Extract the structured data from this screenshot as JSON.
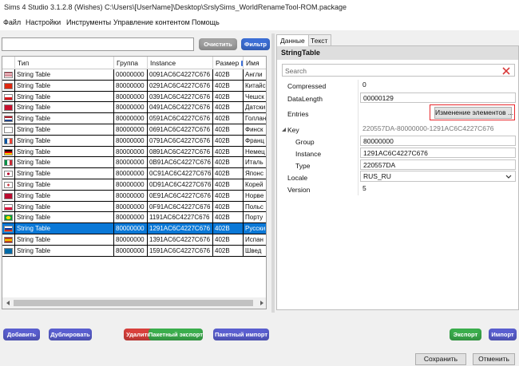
{
  "window": {
    "title": "Sims 4 Studio 3.1.2.8 (Wishes)  C:\\Users\\[UserName]\\Desktop\\SrslySims_WorldRenameTool-ROM.package"
  },
  "menu": [
    "Файл",
    "Настройки",
    "Инструменты",
    "Управление контентом",
    "Помощь"
  ],
  "filter": {
    "value": "",
    "clear_label": "Очистить",
    "filter_label": "Фильтр"
  },
  "table": {
    "columns": [
      "",
      "Тип",
      "Группа",
      "Instance",
      "Размер",
      "Имя"
    ],
    "rows": [
      {
        "flag": "us",
        "type": "String Table",
        "group": "00000000",
        "instance": "0091AC6C4227C676",
        "size": "402B",
        "name": "Англи"
      },
      {
        "flag": "cn",
        "type": "String Table",
        "group": "80000000",
        "instance": "0291AC6C4227C676",
        "size": "402B",
        "name": "Китайс"
      },
      {
        "flag": "cz",
        "type": "String Table",
        "group": "80000000",
        "instance": "0391AC6C4227C676",
        "size": "402B",
        "name": "Чешск"
      },
      {
        "flag": "dk",
        "type": "String Table",
        "group": "80000000",
        "instance": "0491AC6C4227C676",
        "size": "402B",
        "name": "Датски"
      },
      {
        "flag": "nl",
        "type": "String Table",
        "group": "80000000",
        "instance": "0591AC6C4227C676",
        "size": "402B",
        "name": "Голлан"
      },
      {
        "flag": "fi",
        "type": "String Table",
        "group": "80000000",
        "instance": "0691AC6C4227C676",
        "size": "402B",
        "name": "Финск"
      },
      {
        "flag": "fr",
        "type": "String Table",
        "group": "80000000",
        "instance": "0791AC6C4227C676",
        "size": "402B",
        "name": "Франц"
      },
      {
        "flag": "de",
        "type": "String Table",
        "group": "80000000",
        "instance": "0891AC6C4227C676",
        "size": "402B",
        "name": "Немец"
      },
      {
        "flag": "it",
        "type": "String Table",
        "group": "80000000",
        "instance": "0B91AC6C4227C676",
        "size": "402B",
        "name": "Италь"
      },
      {
        "flag": "jp",
        "type": "String Table",
        "group": "80000000",
        "instance": "0C91AC6C4227C676",
        "size": "402B",
        "name": "Японс"
      },
      {
        "flag": "kr",
        "type": "String Table",
        "group": "80000000",
        "instance": "0D91AC6C4227C676",
        "size": "402B",
        "name": "Корей"
      },
      {
        "flag": "no",
        "type": "String Table",
        "group": "80000000",
        "instance": "0E91AC6C4227C676",
        "size": "402B",
        "name": "Норве"
      },
      {
        "flag": "pl",
        "type": "String Table",
        "group": "80000000",
        "instance": "0F91AC6C4227C676",
        "size": "402B",
        "name": "Польс"
      },
      {
        "flag": "br",
        "type": "String Table",
        "group": "80000000",
        "instance": "1191AC6C4227C676",
        "size": "402B",
        "name": "Порту"
      },
      {
        "flag": "ru",
        "type": "String Table",
        "group": "80000000",
        "instance": "1291AC6C4227C676",
        "size": "402B",
        "name": "Русски",
        "selected": true
      },
      {
        "flag": "es",
        "type": "String Table",
        "group": "80000000",
        "instance": "1391AC6C4227C676",
        "size": "402B",
        "name": "Испан"
      },
      {
        "flag": "se",
        "type": "String Table",
        "group": "80000000",
        "instance": "1591AC6C4227C676",
        "size": "402B",
        "name": "Швед"
      }
    ]
  },
  "tabs": {
    "data_label": "Данные",
    "text_label": "Текст"
  },
  "properties": {
    "title": "StringTable",
    "search_placeholder": "Search",
    "compressed_label": "Compressed",
    "compressed_value": "0",
    "datalength_label": "DataLength",
    "datalength_value": "00000129",
    "entries_label": "Entries",
    "entries_button": "Изменение элементов ...",
    "key_label": "Key",
    "key_value": "220557DA-80000000-1291AC6C4227C676",
    "group_label": "Group",
    "group_value": "80000000",
    "instance_label": "Instance",
    "instance_value": "1291AC6C4227C676",
    "type_label": "Type",
    "type_value": "220557DA",
    "locale_label": "Locale",
    "locale_value": "RUS_RU",
    "version_label": "Version",
    "version_value": "5"
  },
  "actions": {
    "add": "Добавить",
    "duplicate": "Дублировать",
    "delete": "Удалить",
    "batch_export": "Пакетный экспорт",
    "batch_import": "Пакетный импорт",
    "export": "Экспорт",
    "import": "Импорт"
  },
  "footer": {
    "save": "Сохранить",
    "cancel": "Отменить"
  },
  "colors": {
    "selection": "#0a78d7",
    "highlight_border": "#e8282d"
  }
}
